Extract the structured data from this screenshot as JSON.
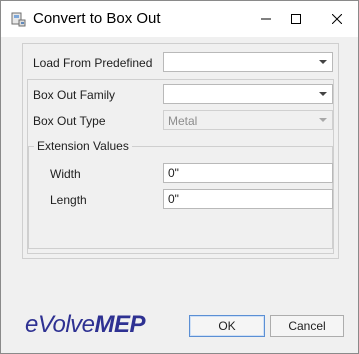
{
  "window": {
    "title": "Convert to Box Out",
    "icons": {
      "app": "convert-app-icon",
      "minimize": "minimize-icon",
      "maximize": "maximize-icon",
      "close": "close-icon"
    }
  },
  "form": {
    "load_predefined_label": "Load From Predefined",
    "load_predefined_value": "",
    "family_label": "Box Out Family",
    "family_value": "",
    "type_label": "Box Out Type",
    "type_value": "Metal",
    "extension": {
      "caption": "Extension Values",
      "width_label": "Width",
      "width_value": "0\"",
      "length_label": "Length",
      "length_value": "0\""
    }
  },
  "footer": {
    "logo_prefix": "eVolve",
    "logo_suffix": "MEP",
    "ok_label": "OK",
    "cancel_label": "Cancel"
  },
  "colors": {
    "logo": "#2e3192",
    "default_button_border": "#5b8fd4"
  }
}
